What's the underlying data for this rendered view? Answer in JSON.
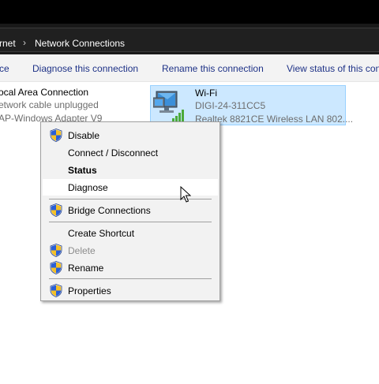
{
  "breadcrumb": {
    "partial_prev": "rnet",
    "separator": "›",
    "current": "Network Connections"
  },
  "command_bar": {
    "partial_left": "ce",
    "diagnose": "Diagnose this connection",
    "rename": "Rename this connection",
    "view_status": "View status of this con"
  },
  "lan_connection": {
    "name": "ocal Area Connection",
    "status": "etwork cable unplugged",
    "adapter": "AP-Windows Adapter V9"
  },
  "wifi_connection": {
    "name": "Wi-Fi",
    "network": "DIGI-24-311CC5",
    "adapter": "Realtek 8821CE Wireless LAN 802...."
  },
  "context_menu": {
    "items": [
      {
        "label": "Disable",
        "icon": "uac-shield-icon"
      },
      {
        "label": "Connect / Disconnect"
      },
      {
        "label": "Status",
        "style": "bold"
      },
      {
        "label": "Diagnose",
        "state": "hover"
      },
      {
        "label": "Bridge Connections",
        "icon": "uac-shield-icon"
      },
      {
        "label": "Create Shortcut"
      },
      {
        "label": "Delete",
        "icon": "uac-shield-icon",
        "state": "disabled"
      },
      {
        "label": "Rename",
        "icon": "uac-shield-icon"
      },
      {
        "label": "Properties",
        "icon": "uac-shield-icon"
      }
    ]
  },
  "colors": {
    "selection_bg": "#cce8ff",
    "selection_border": "#99d1ff",
    "command_link": "#1e3287",
    "menu_bg": "#f2f2f2"
  }
}
